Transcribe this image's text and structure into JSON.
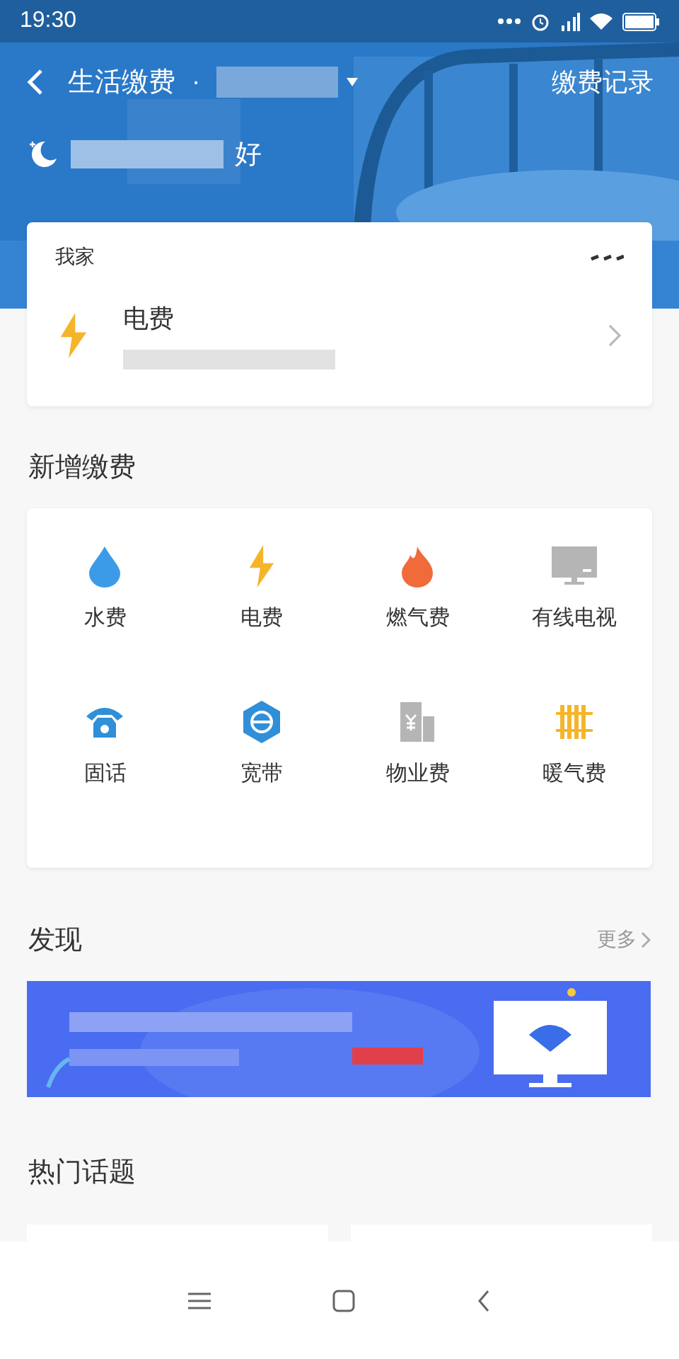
{
  "status_bar": {
    "time": "19:30"
  },
  "header": {
    "title": "生活缴费",
    "separator": "·",
    "action": "缴费记录",
    "greeting_end": "好"
  },
  "home_card": {
    "title": "我家",
    "bill": {
      "name": "电费",
      "kind": "electric"
    }
  },
  "add_section": {
    "title": "新增缴费",
    "items": [
      {
        "label": "水费",
        "kind": "water"
      },
      {
        "label": "电费",
        "kind": "electric"
      },
      {
        "label": "燃气费",
        "kind": "gas"
      },
      {
        "label": "有线电视",
        "kind": "tv"
      },
      {
        "label": "固话",
        "kind": "phone"
      },
      {
        "label": "宽带",
        "kind": "broadband"
      },
      {
        "label": "物业费",
        "kind": "property"
      },
      {
        "label": "暖气费",
        "kind": "heating"
      }
    ]
  },
  "discover": {
    "title": "发现",
    "more": "更多"
  },
  "hot_topics": {
    "title": "热门话题"
  }
}
